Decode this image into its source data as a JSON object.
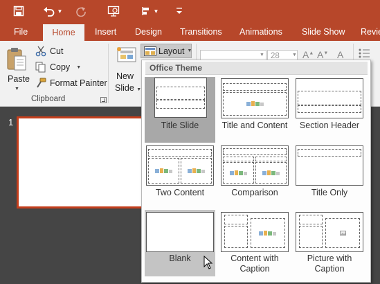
{
  "qat": {
    "icons": [
      "save-icon",
      "undo-icon",
      "redo-icon",
      "start-from-beginning-icon",
      "touch-mode-icon",
      "customize-icon"
    ]
  },
  "tabs": [
    {
      "label": "File",
      "active": false
    },
    {
      "label": "Home",
      "active": true
    },
    {
      "label": "Insert",
      "active": false
    },
    {
      "label": "Design",
      "active": false
    },
    {
      "label": "Transitions",
      "active": false
    },
    {
      "label": "Animations",
      "active": false
    },
    {
      "label": "Slide Show",
      "active": false
    },
    {
      "label": "Revie",
      "active": false
    }
  ],
  "ribbon": {
    "clipboard": {
      "paste_label": "Paste",
      "cut_label": "Cut",
      "copy_label": "Copy",
      "format_painter_label": "Format Painter",
      "group_label": "Clipboard"
    },
    "slides": {
      "new_label": "New",
      "slide_label": "Slide",
      "layout_label": "Layout"
    },
    "font": {
      "font_name": "",
      "font_size": "28"
    }
  },
  "slides_panel": {
    "slide_number": "1"
  },
  "layout_gallery": {
    "header": "Office Theme",
    "items": [
      {
        "label": "Title Slide",
        "selected": true
      },
      {
        "label": "Title and Content",
        "selected": false
      },
      {
        "label": "Section Header",
        "selected": false
      },
      {
        "label": "Two Content",
        "selected": false
      },
      {
        "label": "Comparison",
        "selected": false
      },
      {
        "label": "Title Only",
        "selected": false
      },
      {
        "label": "Blank",
        "selected": false,
        "hovered": true
      },
      {
        "label": "Content with",
        "label2": "Caption",
        "selected": false
      },
      {
        "label": "Picture with",
        "label2": "Caption",
        "selected": false
      }
    ]
  },
  "colors": {
    "accent": "#b7472a",
    "background": "#454545",
    "ribbon": "#f1f1f1",
    "selection_border": "#c43e1c"
  }
}
